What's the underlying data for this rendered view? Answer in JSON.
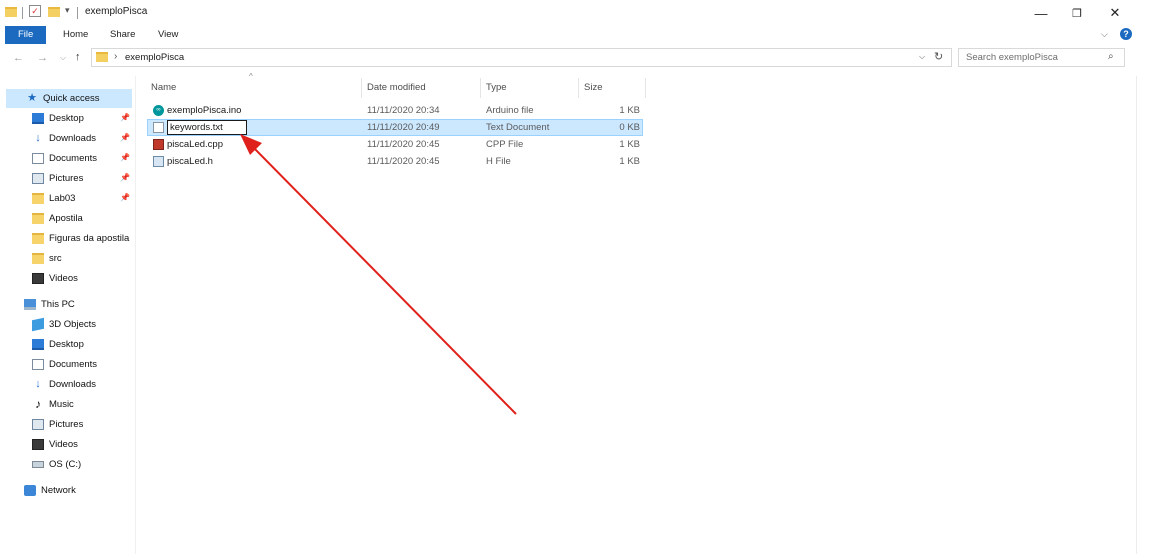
{
  "window": {
    "title": "exemploPisca",
    "minimize": "—",
    "maximize": "❐",
    "close": "✕"
  },
  "ribbon": {
    "tabs": [
      "File",
      "Home",
      "Share",
      "View"
    ]
  },
  "address": {
    "path": "exemploPisca",
    "search_placeholder": "Search exemploPisca"
  },
  "nav": {
    "quick_access": "Quick access",
    "quick_items": [
      "Desktop",
      "Downloads",
      "Documents",
      "Pictures",
      "Lab03",
      "Apostila",
      "Figuras da apostila",
      "src",
      "Videos"
    ],
    "this_pc": "This PC",
    "pc_items": [
      "3D Objects",
      "Desktop",
      "Documents",
      "Downloads",
      "Music",
      "Pictures",
      "Videos",
      "OS (C:)"
    ],
    "network": "Network"
  },
  "columns": {
    "name": "Name",
    "date": "Date modified",
    "type": "Type",
    "size": "Size"
  },
  "files": [
    {
      "name": "exemploPisca.ino",
      "date": "11/11/2020 20:34",
      "type": "Arduino file",
      "size": "1 KB",
      "icon": "arduino-file-icon"
    },
    {
      "name": "keywords.txt",
      "date": "11/11/2020 20:49",
      "type": "Text Document",
      "size": "0 KB",
      "icon": "text-file-icon"
    },
    {
      "name": "piscaLed.cpp",
      "date": "11/11/2020 20:45",
      "type": "CPP File",
      "size": "1 KB",
      "icon": "cpp-file-icon"
    },
    {
      "name": "piscaLed.h",
      "date": "11/11/2020 20:45",
      "type": "H File",
      "size": "1 KB",
      "icon": "h-file-icon"
    }
  ],
  "colors": {
    "accent": "#1b6ac0",
    "selection": "#cce8ff",
    "arrow": "#e0211b"
  }
}
